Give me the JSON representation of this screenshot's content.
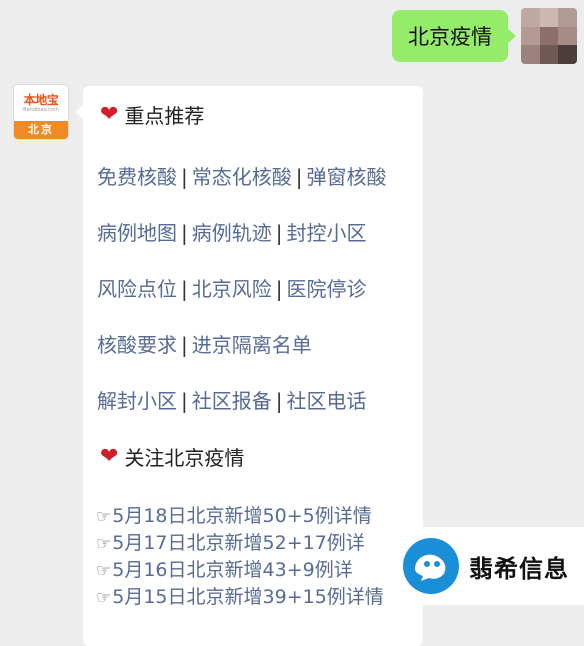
{
  "outgoing": {
    "text": "北京疫情"
  },
  "incoming": {
    "avatar": {
      "brand": "本地宝",
      "sub": "Bendibao.com",
      "city": "北京"
    },
    "section1_title": "重点推荐",
    "links": [
      [
        "免费核酸",
        "常态化核酸",
        "弹窗核酸"
      ],
      [
        "病例地图",
        "病例轨迹",
        "封控小区"
      ],
      [
        "风险点位",
        "北京风险",
        "医院停诊"
      ],
      [
        "核酸要求",
        "进京隔离名单"
      ],
      [
        "解封小区",
        "社区报备",
        "社区电话"
      ]
    ],
    "section2_title": "关注北京疫情",
    "news": [
      "5月18日北京新增50+5例详情",
      "5月17日北京新增52+17例详",
      "5月16日北京新增43+9例详",
      "5月15日北京新增39+15例详情"
    ]
  },
  "watermark": {
    "text": "翡希信息",
    "logo_color": "#1a8fd8"
  },
  "colors": {
    "link": "#576b95",
    "bubble_out": "#95ec69",
    "heart": "#d01e2a"
  }
}
